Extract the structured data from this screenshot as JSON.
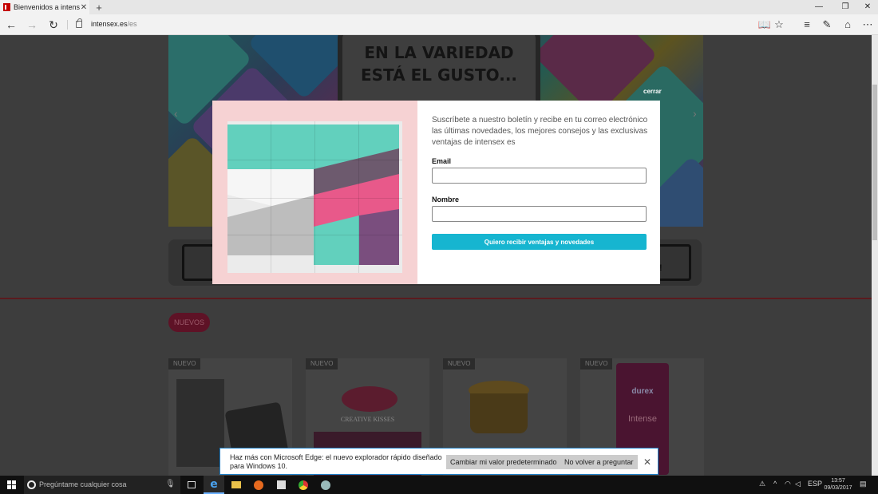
{
  "browser": {
    "tab_title": "Bienvenidos a intensex",
    "url_domain": "intensex.es",
    "url_path": "/es"
  },
  "hero": {
    "line1": "EN LA VARIEDAD",
    "line2": "ESTÁ EL GUSTO..."
  },
  "section": {
    "new_label": "NUEVOS"
  },
  "products": [
    {
      "tag": "NUEVO",
      "name": "CREATIVE KISSES"
    },
    {
      "tag": "NUEVO"
    },
    {
      "tag": "NUEVO"
    },
    {
      "tag": "NUEVO",
      "brand": "durex",
      "name": "Intense"
    }
  ],
  "modal": {
    "close_label": "cerrar",
    "description": "Suscríbete a nuestro boletín y recibe en tu correo electrónico las últimas novedades, los mejores consejos y las exclusivas ventajas de intensex es",
    "email_label": "Email",
    "email_value": "",
    "name_label": "Nombre",
    "name_value": "",
    "submit_label": "Quiero recibir ventajas y novedades",
    "submit_color": "#16b5d0"
  },
  "notification": {
    "text": "Haz más con Microsoft Edge: el nuevo explorador rápido diseñado para Windows 10.",
    "primary_button": "Cambiar mi valor predeterminado",
    "secondary_button": "No volver a preguntar"
  },
  "taskbar": {
    "search_placeholder": "Pregúntame cualquier cosa",
    "language": "ESP",
    "time": "13:57",
    "date": "09/03/2017"
  }
}
